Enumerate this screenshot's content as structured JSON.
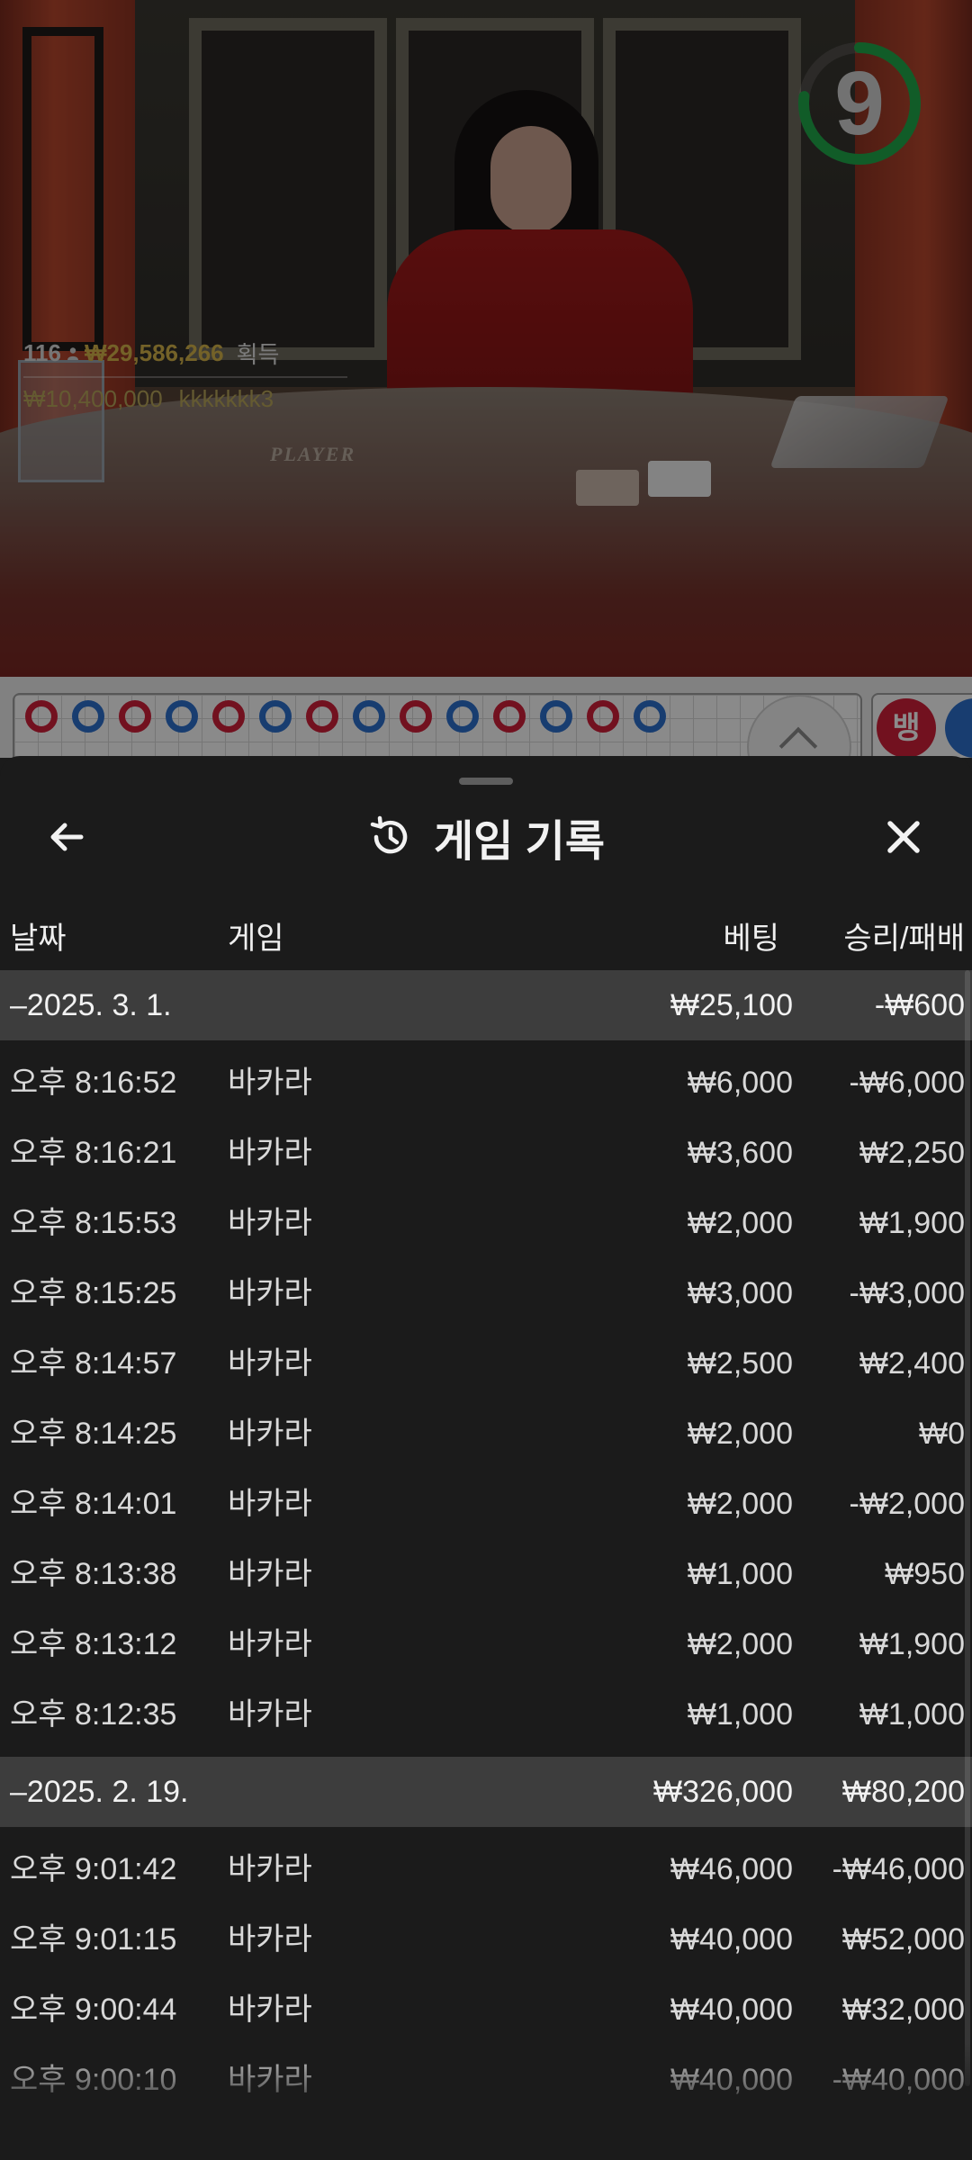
{
  "stream": {
    "countdown": "9",
    "player_count": "116",
    "total_amount": "₩29,586,266",
    "won_label": "획득",
    "ticker_amount": "₩10,400,000",
    "ticker_user": "kkkkkkk3",
    "table_label": "PLAYER",
    "timer_color": "#1fa84a"
  },
  "roadmap": {
    "banker_label": "뱅",
    "banker_color": "#d0203a",
    "player_color": "#2d6fcc",
    "beads_row1": [
      "r",
      "b",
      "r",
      "b",
      "r",
      "b",
      "r",
      "b",
      "r",
      "b",
      "r",
      "b",
      "r",
      "b"
    ]
  },
  "sheet": {
    "title": "게임 기록",
    "back_icon": "arrow-left-icon",
    "history_icon": "history-icon",
    "close_icon": "close-icon"
  },
  "columns": {
    "date": "날짜",
    "game": "게임",
    "bet": "베팅",
    "result": "승리/패배"
  },
  "groups": [
    {
      "date": "–2025. 3. 1.",
      "bet": "₩25,100",
      "result": "-₩600",
      "rows": [
        {
          "time": "오후 8:16:52",
          "game": "바카라",
          "bet": "₩6,000",
          "result": "-₩6,000"
        },
        {
          "time": "오후 8:16:21",
          "game": "바카라",
          "bet": "₩3,600",
          "result": "₩2,250"
        },
        {
          "time": "오후 8:15:53",
          "game": "바카라",
          "bet": "₩2,000",
          "result": "₩1,900"
        },
        {
          "time": "오후 8:15:25",
          "game": "바카라",
          "bet": "₩3,000",
          "result": "-₩3,000"
        },
        {
          "time": "오후 8:14:57",
          "game": "바카라",
          "bet": "₩2,500",
          "result": "₩2,400"
        },
        {
          "time": "오후 8:14:25",
          "game": "바카라",
          "bet": "₩2,000",
          "result": "₩0"
        },
        {
          "time": "오후 8:14:01",
          "game": "바카라",
          "bet": "₩2,000",
          "result": "-₩2,000"
        },
        {
          "time": "오후 8:13:38",
          "game": "바카라",
          "bet": "₩1,000",
          "result": "₩950"
        },
        {
          "time": "오후 8:13:12",
          "game": "바카라",
          "bet": "₩2,000",
          "result": "₩1,900"
        },
        {
          "time": "오후 8:12:35",
          "game": "바카라",
          "bet": "₩1,000",
          "result": "₩1,000"
        }
      ]
    },
    {
      "date": "–2025. 2. 19.",
      "bet": "₩326,000",
      "result": "₩80,200",
      "rows": [
        {
          "time": "오후 9:01:42",
          "game": "바카라",
          "bet": "₩46,000",
          "result": "-₩46,000"
        },
        {
          "time": "오후 9:01:15",
          "game": "바카라",
          "bet": "₩40,000",
          "result": "₩52,000"
        },
        {
          "time": "오후 9:00:44",
          "game": "바카라",
          "bet": "₩40,000",
          "result": "₩32,000"
        },
        {
          "time": "오후 9:00:10",
          "game": "바카라",
          "bet": "₩40,000",
          "result": "-₩40,000"
        }
      ]
    }
  ]
}
